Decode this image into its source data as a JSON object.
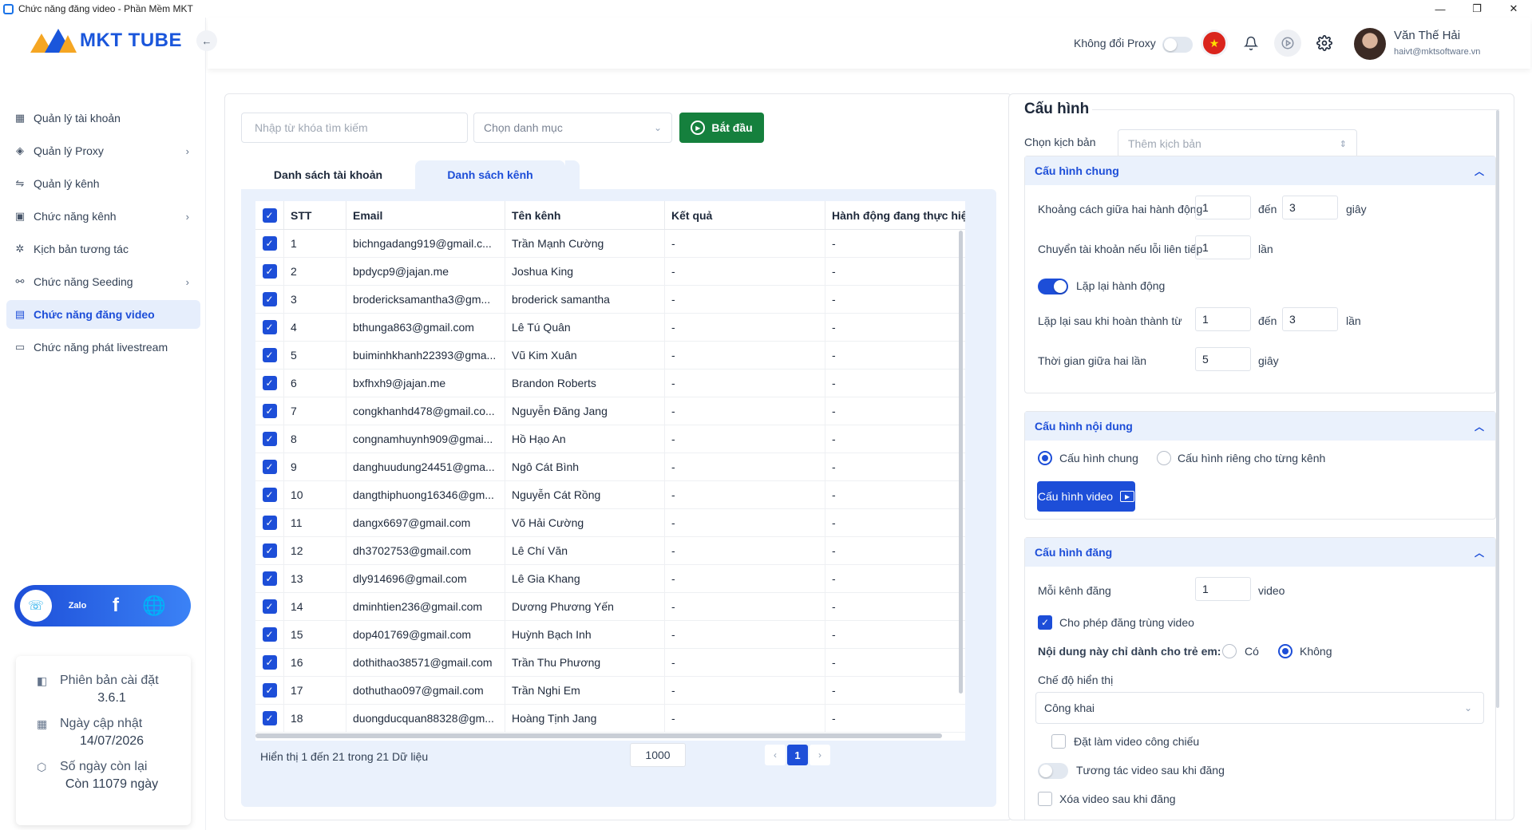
{
  "window": {
    "title": "Chức năng đăng video - Phần Mềm MKT",
    "controls": [
      "—",
      "❐",
      "✕"
    ]
  },
  "sidebar": {
    "logo_text": "MKT TUBE",
    "menu": [
      {
        "label": "Quản lý tài khoản",
        "icon": "grid-icon",
        "glyph": "▦",
        "has_children": false,
        "active": false
      },
      {
        "label": "Quản lý Proxy",
        "icon": "layers-icon",
        "glyph": "◈",
        "has_children": true,
        "active": false
      },
      {
        "label": "Quản lý kênh",
        "icon": "channel-icon",
        "glyph": "⇋",
        "has_children": false,
        "active": false
      },
      {
        "label": "Chức năng kênh",
        "icon": "monitor-icon",
        "glyph": "▣",
        "has_children": true,
        "active": false
      },
      {
        "label": "Kịch bản tương tác",
        "icon": "sparkle-icon",
        "glyph": "✲",
        "has_children": false,
        "active": false
      },
      {
        "label": "Chức năng Seeding",
        "icon": "seeding-icon",
        "glyph": "⚯",
        "has_children": true,
        "active": false
      },
      {
        "label": "Chức năng đăng video",
        "icon": "upload-video-icon",
        "glyph": "▤",
        "has_children": false,
        "active": true
      },
      {
        "label": "Chức năng phát livestream",
        "icon": "livestream-icon",
        "glyph": "▭",
        "has_children": false,
        "active": false
      }
    ],
    "social": {
      "zalo_label": "Zalo",
      "facebook_glyph": "f",
      "web_glyph": "🌐",
      "support_glyph": "☏"
    },
    "info": {
      "version_label": "Phiên bản cài đặt",
      "version_value": "3.6.1",
      "update_label": "Ngày cập nhật",
      "update_value": "14/07/2026",
      "days_label": "Số ngày còn lại",
      "days_value": "Còn 11079 ngày"
    }
  },
  "header": {
    "proxy_label": "Không đổi Proxy",
    "proxy_toggle_on": false,
    "user_name": "Văn Thế Hải",
    "user_email": "haivt@mktsoftware.vn"
  },
  "toolbar": {
    "search_placeholder": "Nhập từ khóa tìm kiếm",
    "category_placeholder": "Chọn danh mục",
    "start_label": "Bắt đầu"
  },
  "tabs": [
    {
      "label": "Danh sách tài khoản",
      "active": false
    },
    {
      "label": "Danh sách kênh",
      "active": true
    }
  ],
  "table": {
    "columns": [
      "STT",
      "Email",
      "Tên kênh",
      "Kết quả",
      "Hành động đang thực hiện"
    ],
    "rows": [
      {
        "stt": "1",
        "email": "bichngadang919@gmail.c...",
        "name": "Trần Mạnh Cường",
        "result": "-",
        "action": "-"
      },
      {
        "stt": "2",
        "email": "bpdycp9@jajan.me",
        "name": "Joshua King",
        "result": "-",
        "action": "-"
      },
      {
        "stt": "3",
        "email": "brodericksamantha3@gm...",
        "name": "broderick samantha",
        "result": "-",
        "action": "-"
      },
      {
        "stt": "4",
        "email": "bthunga863@gmail.com",
        "name": "Lê Tú Quân",
        "result": "-",
        "action": "-"
      },
      {
        "stt": "5",
        "email": "buiminhkhanh22393@gma...",
        "name": "Vũ Kim Xuân",
        "result": "-",
        "action": "-"
      },
      {
        "stt": "6",
        "email": "bxfhxh9@jajan.me",
        "name": "Brandon Roberts",
        "result": "-",
        "action": "-"
      },
      {
        "stt": "7",
        "email": "congkhanhd478@gmail.co...",
        "name": "Nguyễn Đăng Jang",
        "result": "-",
        "action": "-"
      },
      {
        "stt": "8",
        "email": "congnamhuynh909@gmai...",
        "name": "Hồ Hạo An",
        "result": "-",
        "action": "-"
      },
      {
        "stt": "9",
        "email": "danghuudung24451@gma...",
        "name": "Ngô Cát Bình",
        "result": "-",
        "action": "-"
      },
      {
        "stt": "10",
        "email": "dangthiphuong16346@gm...",
        "name": "Nguyễn Cát Rồng",
        "result": "-",
        "action": "-"
      },
      {
        "stt": "11",
        "email": "dangx6697@gmail.com",
        "name": "Võ Hải Cường",
        "result": "-",
        "action": "-"
      },
      {
        "stt": "12",
        "email": "dh3702753@gmail.com",
        "name": "Lê Chí Văn",
        "result": "-",
        "action": "-"
      },
      {
        "stt": "13",
        "email": "dly914696@gmail.com",
        "name": "Lê Gia Khang",
        "result": "-",
        "action": "-"
      },
      {
        "stt": "14",
        "email": "dminhtien236@gmail.com",
        "name": "Dương Phương Yến",
        "result": "-",
        "action": "-"
      },
      {
        "stt": "15",
        "email": "dop401769@gmail.com",
        "name": "Huỳnh Bạch Inh",
        "result": "-",
        "action": "-"
      },
      {
        "stt": "16",
        "email": "dothithao38571@gmail.com",
        "name": "Trần Thu Phương",
        "result": "-",
        "action": "-"
      },
      {
        "stt": "17",
        "email": "dothuthao097@gmail.com",
        "name": "Trần Nghi Em",
        "result": "-",
        "action": "-"
      },
      {
        "stt": "18",
        "email": "duongducquan88328@gm...",
        "name": "Hoàng Tịnh Jang",
        "result": "-",
        "action": "-"
      }
    ],
    "footer_info": "Hiển thị 1 đến 21 trong 21 Dữ liệu",
    "page_size": "1000",
    "current_page": "1"
  },
  "config": {
    "title": "Cấu hình",
    "scenario_label": "Chọn kịch bản",
    "scenario_placeholder": "Thêm kịch bản",
    "general": {
      "title": "Cấu hình chung",
      "interval_label": "Khoảng cách giữa hai hành động",
      "interval_from": "1",
      "to_label": "đến",
      "interval_to": "3",
      "seconds_label": "giây",
      "switch_label": "Chuyển tài khoản nếu lỗi liên tiếp",
      "switch_value": "1",
      "times_label": "lần",
      "repeat_label": "Lặp lại hành động",
      "repeat_on": true,
      "repeat_after_label": "Lặp lại sau khi hoàn thành từ",
      "repeat_from": "1",
      "repeat_to": "3",
      "wait_label": "Thời gian giữa hai lần",
      "wait_value": "5"
    },
    "content": {
      "title": "Cấu hình nội dung",
      "option_general": "Cấu hình chung",
      "option_per_channel": "Cấu hình riêng cho từng kênh",
      "video_btn": "Cấu hình video"
    },
    "post": {
      "title": "Cấu hình đăng",
      "per_channel_label": "Mỗi kênh đăng",
      "per_channel_value": "1",
      "video_unit": "video",
      "allow_duplicate": "Cho phép đăng trùng video",
      "kids_label": "Nội dung này chỉ dành cho trẻ em:",
      "kids_yes": "Có",
      "kids_no": "Không",
      "display_mode_label": "Chế độ hiển thị",
      "display_mode_value": "Công khai",
      "premiere_label": "Đặt làm video công chiếu",
      "interact_label": "Tương tác video sau khi đăng",
      "delete_label": "Xóa video sau khi đăng"
    }
  },
  "colors": {
    "primary": "#1d4ed8",
    "success": "#15803d",
    "tab_bg": "#eaf1fc"
  }
}
